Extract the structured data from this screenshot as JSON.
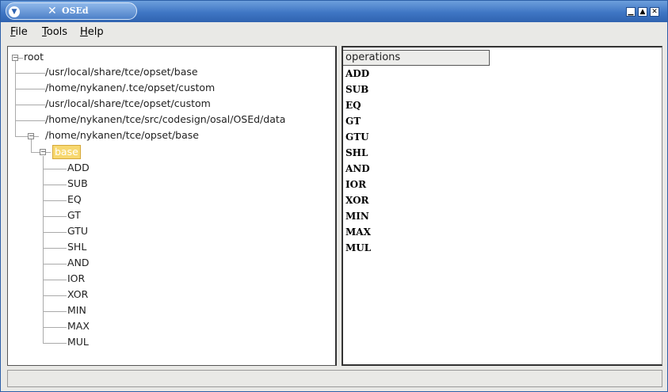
{
  "window": {
    "title": "OSEd",
    "controls": {
      "minimize": "▁",
      "maximize": "▲",
      "close": "✕"
    }
  },
  "menubar": {
    "items": [
      {
        "label": "File",
        "mnemonic": "F",
        "rest": "ile"
      },
      {
        "label": "Tools",
        "mnemonic": "T",
        "rest": "ools"
      },
      {
        "label": "Help",
        "mnemonic": "H",
        "rest": "elp"
      }
    ]
  },
  "tree": {
    "root": "root",
    "paths": [
      "/usr/local/share/tce/opset/base",
      "/home/nykanen/.tce/opset/custom",
      "/usr/local/share/tce/opset/custom",
      "/home/nykanen/tce/src/codesign/osal/OSEd/data",
      "/home/nykanen/tce/opset/base"
    ],
    "selected_module": "base",
    "operations": [
      "ADD",
      "SUB",
      "EQ",
      "GT",
      "GTU",
      "SHL",
      "AND",
      "IOR",
      "XOR",
      "MIN",
      "MAX",
      "MUL"
    ]
  },
  "list": {
    "column_header": "operations",
    "rows": [
      "ADD",
      "SUB",
      "EQ",
      "GT",
      "GTU",
      "SHL",
      "AND",
      "IOR",
      "XOR",
      "MIN",
      "MAX",
      "MUL"
    ]
  },
  "icons": {
    "window_menu": "chevron-down-icon",
    "app_icon": "x-icon",
    "expander": "minus-icon"
  }
}
